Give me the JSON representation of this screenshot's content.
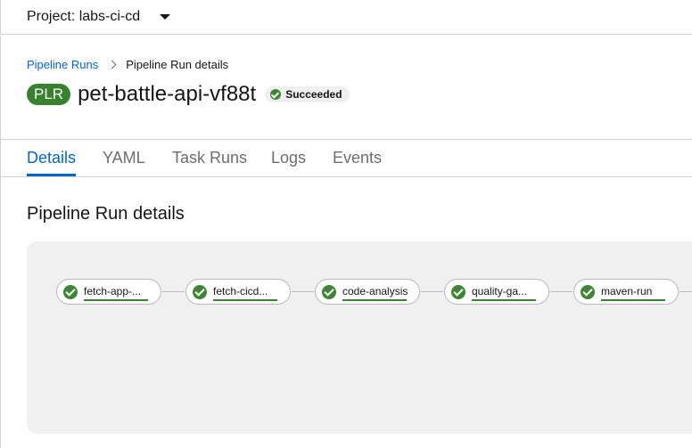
{
  "header": {
    "project_label": "Project: labs-ci-cd"
  },
  "breadcrumb": {
    "parent": "Pipeline Runs",
    "current": "Pipeline Run details"
  },
  "page": {
    "badge": "PLR",
    "title": "pet-battle-api-vf88t",
    "status": "Succeeded"
  },
  "tabs": [
    {
      "label": "Details",
      "active": true
    },
    {
      "label": "YAML"
    },
    {
      "label": "Task Runs"
    },
    {
      "label": "Logs"
    },
    {
      "label": "Events"
    }
  ],
  "section": {
    "title": "Pipeline Run details"
  },
  "pipeline": {
    "tasks": [
      {
        "label": "fetch-app-...",
        "status": "succeeded"
      },
      {
        "label": "fetch-cicd...",
        "status": "succeeded"
      },
      {
        "label": "code-analysis",
        "status": "succeeded"
      },
      {
        "label": "quality-ga...",
        "status": "succeeded"
      },
      {
        "label": "maven-run",
        "status": "succeeded"
      }
    ]
  },
  "colors": {
    "success": "#3e8635",
    "link": "#0066cc",
    "badge": "#38812f"
  }
}
